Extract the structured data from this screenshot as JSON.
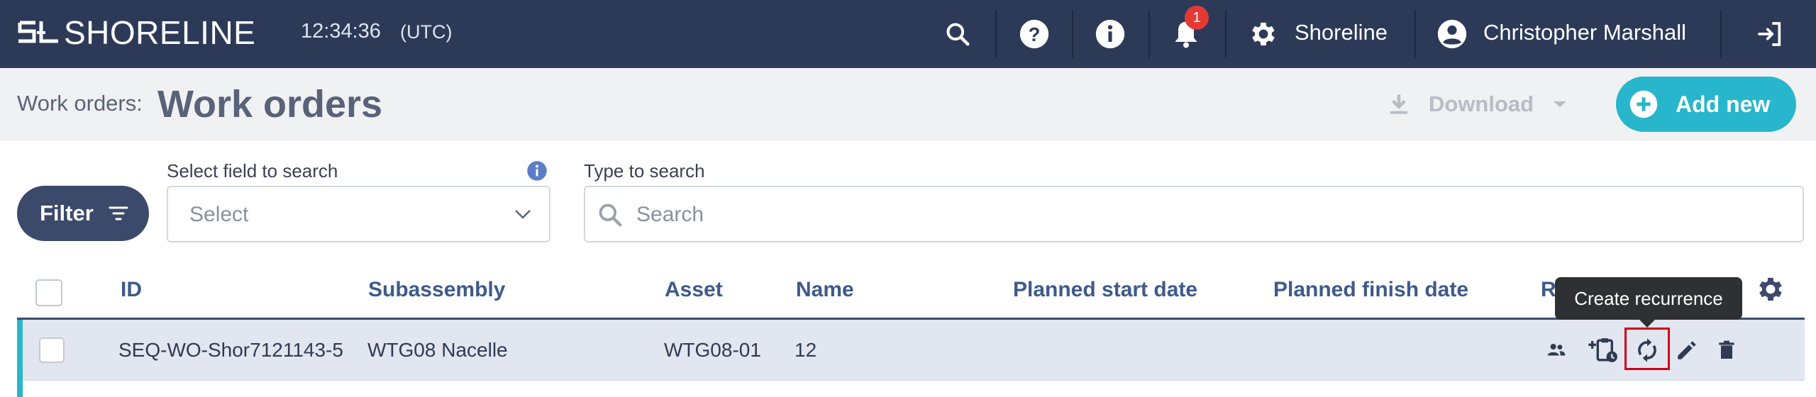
{
  "topbar": {
    "logo_text": "SHORELINE",
    "time": "12:34:36",
    "timezone": "(UTC)",
    "notification_count": "1",
    "org_name": "Shoreline",
    "user_name": "Christopher Marshall"
  },
  "header": {
    "breadcrumb": "Work orders:",
    "title": "Work orders",
    "download_label": "Download",
    "add_new_label": "Add new"
  },
  "filters": {
    "filter_label": "Filter",
    "field_label": "Select field to search",
    "field_placeholder": "Select",
    "search_label": "Type to search",
    "search_placeholder": "Search"
  },
  "table": {
    "columns": [
      "ID",
      "Subassembly",
      "Asset",
      "Name",
      "Planned start date",
      "Planned finish date",
      "R"
    ],
    "rows": [
      {
        "id": "SEQ-WO-Shor7121143-5",
        "subassembly": "WTG08 Nacelle",
        "asset": "WTG08-01",
        "name": "12",
        "planned_start": "",
        "planned_finish": ""
      }
    ]
  },
  "tooltip": {
    "text": "Create recurrence"
  },
  "icons": [
    "logo-icon",
    "search-icon",
    "help-icon",
    "info-icon",
    "bell-icon",
    "gear-icon",
    "user-icon",
    "logout-icon",
    "download-icon",
    "chevron-down-icon",
    "plus-circle-icon",
    "filter-icon",
    "search-icon",
    "settings-icon",
    "people-icon",
    "add-clipboard-icon",
    "recurrence-icon",
    "edit-icon",
    "delete-icon"
  ],
  "colors": {
    "topbar": "#2c3a58",
    "accent": "#27b6cb",
    "primary": "#3b4a6b",
    "badge": "#e53935",
    "highlight": "#d0021b"
  }
}
